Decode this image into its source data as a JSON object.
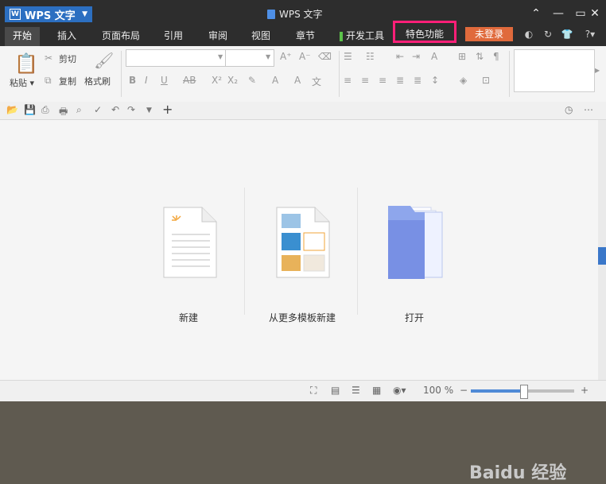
{
  "window": {
    "app_button": "WPS 文字",
    "title": "WPS 文字"
  },
  "tabs": [
    {
      "label": "开始",
      "active": true
    },
    {
      "label": "插入"
    },
    {
      "label": "页面布局"
    },
    {
      "label": "引用"
    },
    {
      "label": "审阅"
    },
    {
      "label": "视图"
    },
    {
      "label": "章节"
    },
    {
      "label": "开发工具"
    },
    {
      "label": "特色功能"
    }
  ],
  "account": {
    "login_label": "未登录",
    "help_label": "?"
  },
  "ribbon": {
    "paste_label": "粘贴",
    "cut_label": "剪切",
    "copy_label": "复制",
    "format_painter_label": "格式刷",
    "font_name": "",
    "font_size": ""
  },
  "home": {
    "new_label": "新建",
    "template_label": "从更多模板新建",
    "open_label": "打开"
  },
  "status": {
    "zoom": "100 %"
  },
  "watermark": "Baidu 经验",
  "colors": {
    "accent": "#2c6fc1",
    "highlight": "#ff1f78",
    "login": "#e06a3c"
  }
}
